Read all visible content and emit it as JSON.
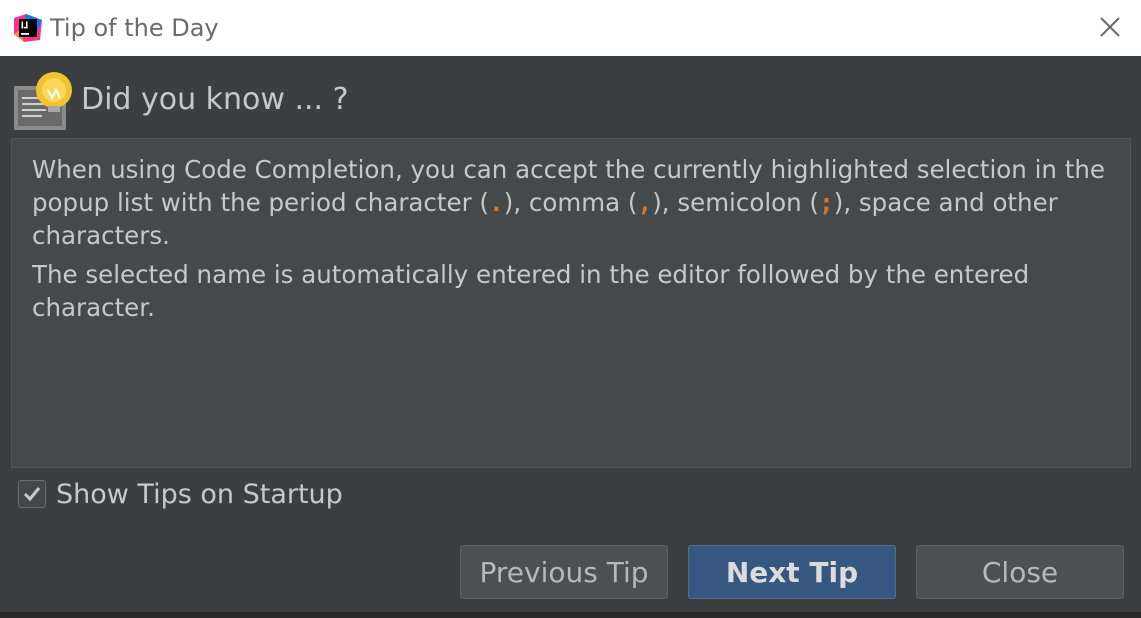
{
  "window": {
    "title": "Tip of the Day",
    "app_icon": "intellij-idea-icon",
    "close_icon": "close-icon"
  },
  "heading": {
    "icon": "lightbulb-icon",
    "text": "Did you know ... ?"
  },
  "tip": {
    "para1_part1": "When using Code Completion, you can accept the currently highlighted selection in the popup list with the period character (",
    "code_period": ".",
    "para1_part2": "), comma (",
    "code_comma": ",",
    "para1_part3": "), semicolon (",
    "code_semicolon": ";",
    "para1_part4": "), space and other characters.",
    "para2": "The selected name is automatically entered in the editor followed by the entered character.",
    "code_color": "#cc7832"
  },
  "startup": {
    "label": "Show Tips on Startup",
    "checked": true
  },
  "buttons": {
    "previous": "Previous Tip",
    "next": "Next Tip",
    "close": "Close"
  },
  "colors": {
    "background": "#3c3f41",
    "panel": "#45494a",
    "primary_button": "#365880",
    "text": "#c8c8c8"
  }
}
